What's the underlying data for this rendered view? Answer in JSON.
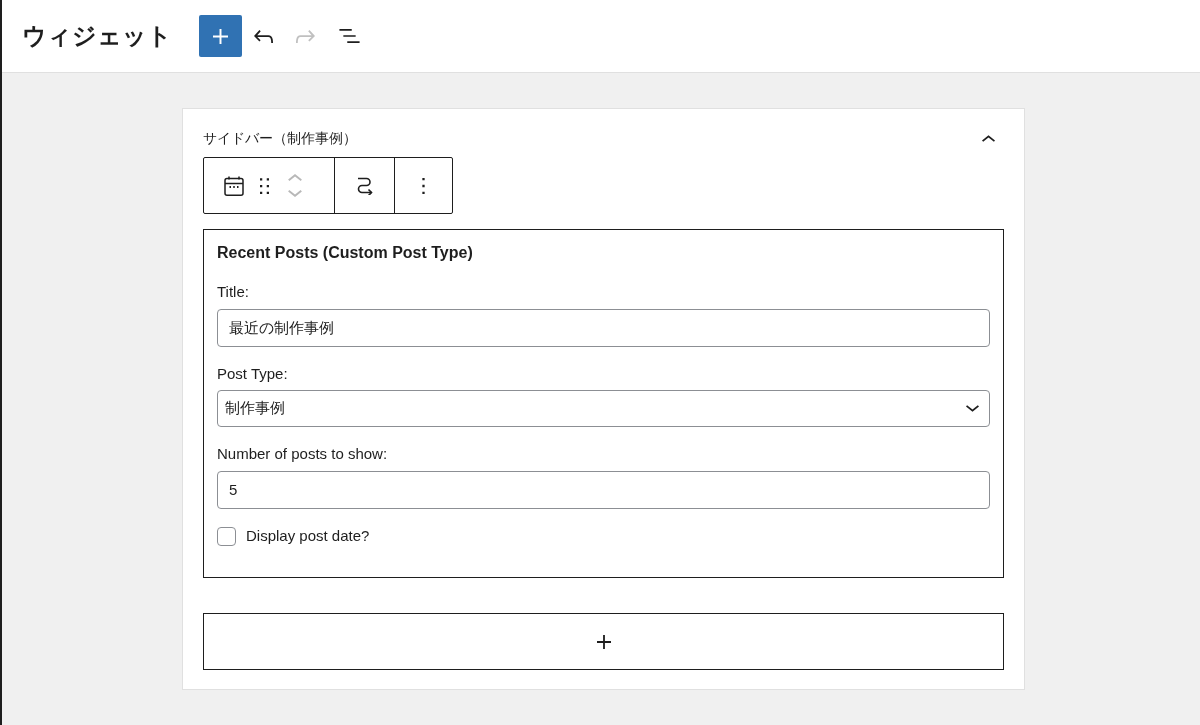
{
  "header": {
    "title": "ウィジェット",
    "tools": [
      {
        "kind": "inserter"
      },
      {
        "kind": "undo",
        "disabled": false
      },
      {
        "kind": "redo",
        "disabled": true
      },
      {
        "kind": "list_view"
      }
    ]
  },
  "widget_area": {
    "title": "サイドバー（制作事例）",
    "expanded": true,
    "block_toolbar": {
      "movers": [
        {
          "kind": "up",
          "disabled": true
        },
        {
          "kind": "down",
          "disabled": true
        }
      ]
    },
    "widget": {
      "heading": "Recent Posts (Custom Post Type)",
      "fields": [
        {
          "kind": "text",
          "label": "Title:",
          "value": "最近の制作事例"
        },
        {
          "kind": "select",
          "label": "Post Type:",
          "value": "制作事例"
        },
        {
          "kind": "text",
          "label": "Number of posts to show:",
          "value": "5"
        },
        {
          "kind": "checkbox",
          "label": "Display post date?",
          "checked": false
        }
      ]
    }
  }
}
